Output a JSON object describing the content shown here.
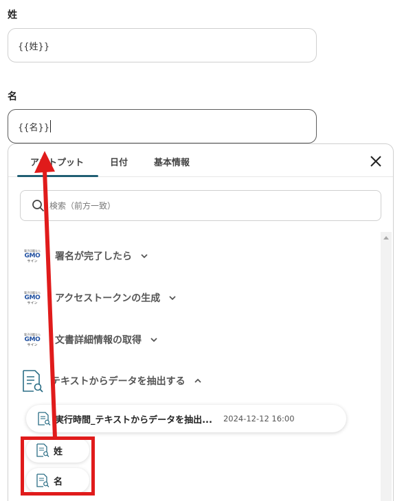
{
  "form": {
    "last_name_label": "姓",
    "last_name_value": "{{姓}}",
    "first_name_label": "名",
    "first_name_value": "{{名}}"
  },
  "panel": {
    "tabs": [
      {
        "label": "アウトプット",
        "active": true
      },
      {
        "label": "日付",
        "active": false
      },
      {
        "label": "基本情報",
        "active": false
      }
    ],
    "search_placeholder": "検索（前方一致）",
    "gmo_logo": {
      "top": "電子印鑑なら",
      "mid": "GMO",
      "bot": "サイン"
    },
    "items": [
      {
        "label": "署名が完了したら",
        "icon": "gmo-sign-logo",
        "expanded": false
      },
      {
        "label": "アクセストークンの生成",
        "icon": "gmo-sign-logo",
        "expanded": false
      },
      {
        "label": "文書詳細情報の取得",
        "icon": "gmo-sign-logo",
        "expanded": false
      },
      {
        "label": "テキストからデータを抽出する",
        "icon": "document-search-icon",
        "expanded": true
      }
    ],
    "sub_item": {
      "title": "実行時間_テキストからデータを抽出...",
      "date": "2024-12-12 16:00"
    },
    "leaves": [
      {
        "label": "姓"
      },
      {
        "label": "名"
      }
    ]
  },
  "colors": {
    "tab_underline": "#1f5e73",
    "annotation_red": "#e01b1b",
    "icon_teal": "#2a6d85"
  }
}
